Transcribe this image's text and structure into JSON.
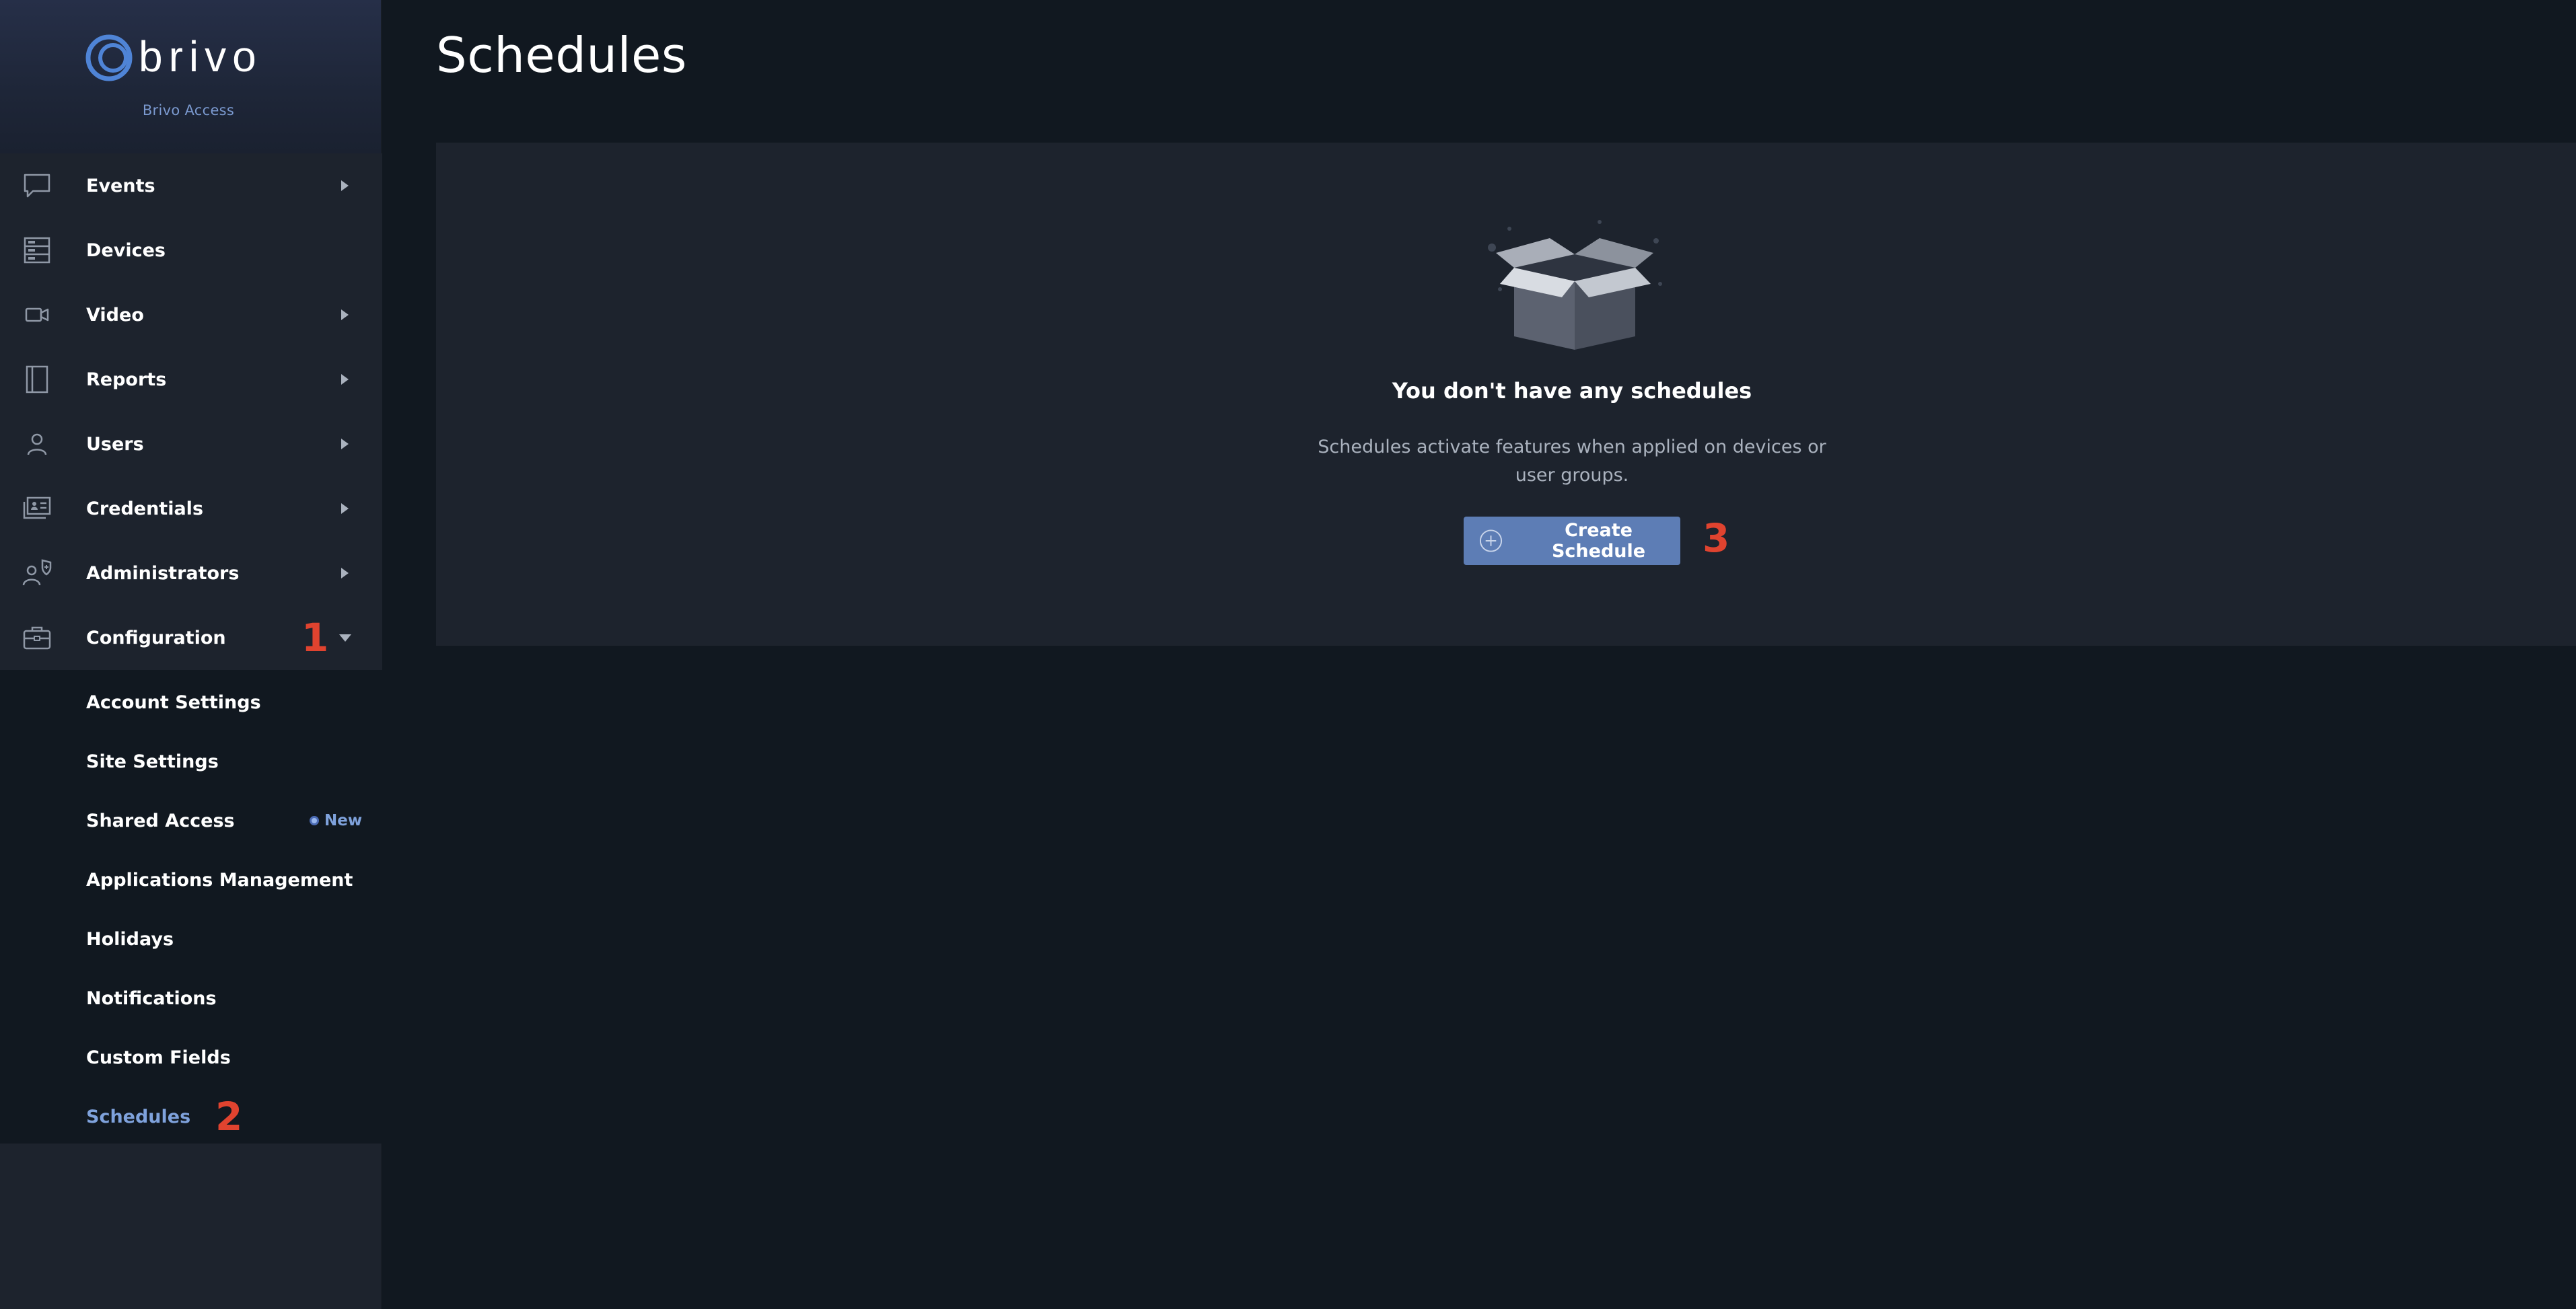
{
  "brand": {
    "name": "brivo",
    "subtitle": "Brivo Access"
  },
  "sidebar": {
    "items": [
      {
        "label": "Events",
        "icon": "message-icon",
        "has_caret": true
      },
      {
        "label": "Devices",
        "icon": "server-icon",
        "has_caret": false
      },
      {
        "label": "Video",
        "icon": "video-camera-icon",
        "has_caret": true
      },
      {
        "label": "Reports",
        "icon": "report-book-icon",
        "has_caret": true
      },
      {
        "label": "Users",
        "icon": "user-icon",
        "has_caret": true
      },
      {
        "label": "Credentials",
        "icon": "id-card-icon",
        "has_caret": true
      },
      {
        "label": "Administrators",
        "icon": "admin-shield-icon",
        "has_caret": true
      },
      {
        "label": "Configuration",
        "icon": "briefcase-icon",
        "has_caret": true,
        "expanded": true
      }
    ],
    "sub_items": [
      {
        "label": "Account Settings"
      },
      {
        "label": "Site Settings"
      },
      {
        "label": "Shared Access",
        "badge": "New"
      },
      {
        "label": "Applications Management"
      },
      {
        "label": "Holidays"
      },
      {
        "label": "Notifications"
      },
      {
        "label": "Custom Fields"
      },
      {
        "label": "Schedules",
        "active": true
      }
    ]
  },
  "page": {
    "title": "Schedules",
    "empty_state": {
      "icon": "open-box-icon",
      "title": "You don't have any schedules",
      "description": "Schedules activate features when applied on devices or user groups.",
      "button_label": "Create Schedule"
    }
  },
  "annotations": {
    "step1": "1",
    "step2": "2",
    "step3": "3"
  },
  "colors": {
    "accent": "#5d7db5",
    "active_text": "#7fa2dc",
    "annotation": "#e0432f",
    "sidebar_bg": "#1d232d",
    "page_bg": "#111820"
  }
}
